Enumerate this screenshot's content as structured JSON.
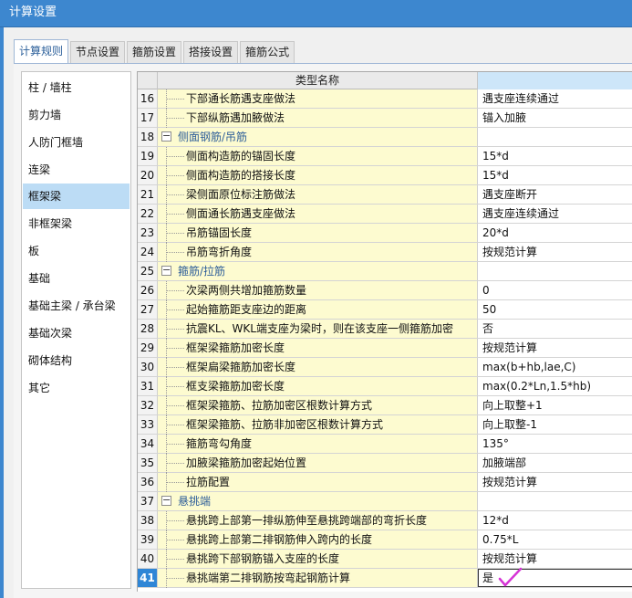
{
  "window": {
    "title": "计算设置"
  },
  "tabs": [
    {
      "label": "计算规则",
      "active": true
    },
    {
      "label": "节点设置",
      "active": false
    },
    {
      "label": "箍筋设置",
      "active": false
    },
    {
      "label": "搭接设置",
      "active": false
    },
    {
      "label": "箍筋公式",
      "active": false
    }
  ],
  "sidebar": {
    "selected": "框架梁",
    "items": [
      "柱 / 墙柱",
      "剪力墙",
      "人防门框墙",
      "连梁",
      "框架梁",
      "非框架梁",
      "板",
      "基础",
      "基础主梁 / 承台梁",
      "基础次梁",
      "砌体结构",
      "其它"
    ]
  },
  "grid": {
    "header": {
      "name": "类型名称",
      "value": ""
    },
    "rows": [
      {
        "num": "16",
        "type": "item",
        "name": "下部通长筋遇支座做法",
        "value": "遇支座连续通过"
      },
      {
        "num": "17",
        "type": "item",
        "name": "下部纵筋遇加腋做法",
        "value": "锚入加腋"
      },
      {
        "num": "18",
        "type": "group",
        "name": "侧面钢筋/吊筋",
        "value": ""
      },
      {
        "num": "19",
        "type": "item",
        "name": "侧面构造筋的锚固长度",
        "value": "15*d"
      },
      {
        "num": "20",
        "type": "item",
        "name": "侧面构造筋的搭接长度",
        "value": "15*d"
      },
      {
        "num": "21",
        "type": "item",
        "name": "梁侧面原位标注筋做法",
        "value": "遇支座断开"
      },
      {
        "num": "22",
        "type": "item",
        "name": "侧面通长筋遇支座做法",
        "value": "遇支座连续通过"
      },
      {
        "num": "23",
        "type": "item",
        "name": "吊筋锚固长度",
        "value": "20*d"
      },
      {
        "num": "24",
        "type": "item",
        "name": "吊筋弯折角度",
        "value": "按规范计算"
      },
      {
        "num": "25",
        "type": "group",
        "name": "箍筋/拉筋",
        "value": ""
      },
      {
        "num": "26",
        "type": "item",
        "name": "次梁两侧共增加箍筋数量",
        "value": "0"
      },
      {
        "num": "27",
        "type": "item",
        "name": "起始箍筋距支座边的距离",
        "value": "50"
      },
      {
        "num": "28",
        "type": "item",
        "name": "抗震KL、WKL端支座为梁时，则在该支座一侧箍筋加密",
        "value": "否"
      },
      {
        "num": "29",
        "type": "item",
        "name": "框架梁箍筋加密长度",
        "value": "按规范计算"
      },
      {
        "num": "30",
        "type": "item",
        "name": "框架扁梁箍筋加密长度",
        "value": "max(b+hb,lae,C)"
      },
      {
        "num": "31",
        "type": "item",
        "name": "框支梁箍筋加密长度",
        "value": "max(0.2*Ln,1.5*hb)"
      },
      {
        "num": "32",
        "type": "item",
        "name": "框架梁箍筋、拉筋加密区根数计算方式",
        "value": "向上取整+1"
      },
      {
        "num": "33",
        "type": "item",
        "name": "框架梁箍筋、拉筋非加密区根数计算方式",
        "value": "向上取整-1"
      },
      {
        "num": "34",
        "type": "item",
        "name": "箍筋弯勾角度",
        "value": "135°"
      },
      {
        "num": "35",
        "type": "item",
        "name": "加腋梁箍筋加密起始位置",
        "value": "加腋端部"
      },
      {
        "num": "36",
        "type": "item",
        "name": "拉筋配置",
        "value": "按规范计算"
      },
      {
        "num": "37",
        "type": "group",
        "name": "悬挑端",
        "value": ""
      },
      {
        "num": "38",
        "type": "item",
        "name": "悬挑跨上部第一排纵筋伸至悬挑跨端部的弯折长度",
        "value": "12*d"
      },
      {
        "num": "39",
        "type": "item",
        "name": "悬挑跨上部第二排钢筋伸入跨内的长度",
        "value": "0.75*L"
      },
      {
        "num": "40",
        "type": "item",
        "name": "悬挑跨下部钢筋锚入支座的长度",
        "value": "按规范计算"
      },
      {
        "num": "41",
        "type": "item",
        "name": "悬挑端第二排钢筋按弯起钢筋计算",
        "value": "是",
        "current": true
      }
    ]
  },
  "colors": {
    "titlebar": "#3d87cf",
    "selected_row_number": "#2f86d6",
    "name_cell_bg": "#fdfbd0",
    "check_mark": "#d633d6"
  }
}
